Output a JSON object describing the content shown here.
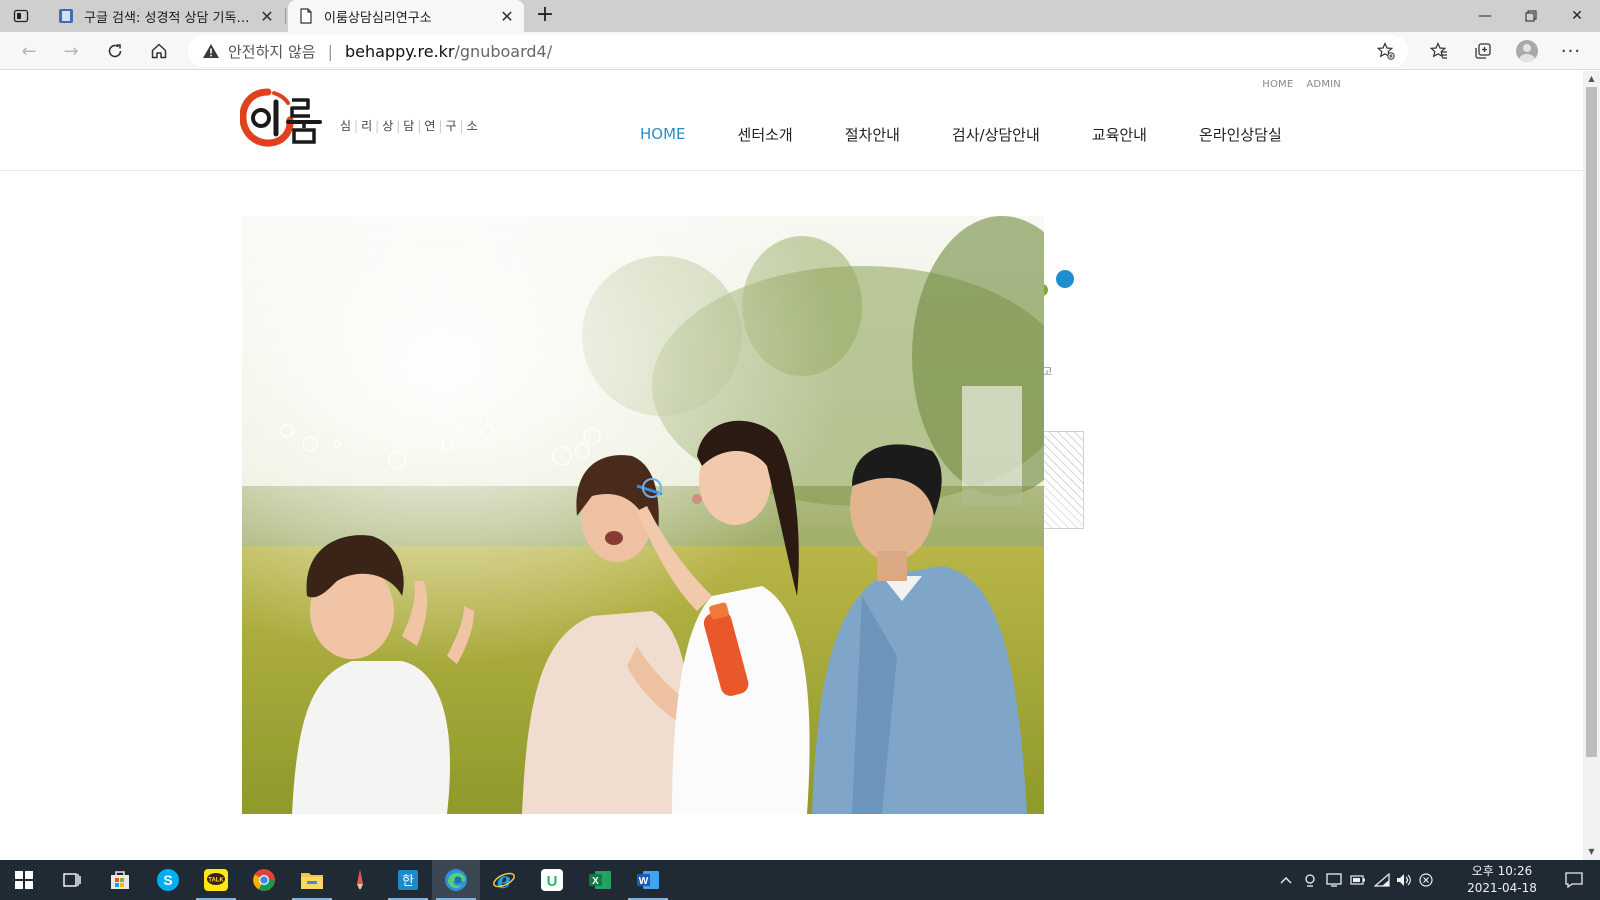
{
  "browser": {
    "tabs": [
      {
        "title": "구글 검색: 성경적 상담 기독교 상담",
        "active": false
      },
      {
        "title": "이룸상담심리연구소",
        "active": true
      }
    ],
    "address": {
      "security_label": "안전하지 않음",
      "host": "behappy.re.kr",
      "path": "/gnuboard4/"
    }
  },
  "site": {
    "util_nav": [
      "HOME",
      "ADMIN"
    ],
    "logo": {
      "mark_text": "이룸",
      "subtitle_chars": [
        "심",
        "리",
        "상",
        "담",
        "연",
        "구",
        "소"
      ],
      "accent_color": "#e0401c"
    },
    "nav": [
      {
        "label": "HOME",
        "active": true
      },
      {
        "label": "센터소개",
        "active": false
      },
      {
        "label": "절차안내",
        "active": false
      },
      {
        "label": "검사/상담안내",
        "active": false
      },
      {
        "label": "교육안내",
        "active": false
      },
      {
        "label": "온라인상담실",
        "active": false
      }
    ],
    "nav_active_color": "#2b8cc7",
    "hero": {
      "description": "family blowing soap bubbles on a sunny lawn"
    },
    "deco_char": "고"
  },
  "taskbar": {
    "apps": [
      "start",
      "task-view",
      "store",
      "skype",
      "kakaotalk",
      "chrome",
      "file-explorer",
      "pencil",
      "hangul",
      "edge",
      "internet-explorer",
      "unote",
      "excel",
      "word"
    ],
    "clock": {
      "time": "오후 10:26",
      "date": "2021-04-18"
    }
  }
}
